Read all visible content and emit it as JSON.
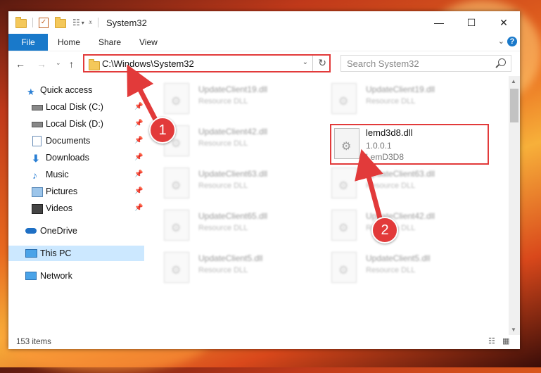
{
  "window": {
    "title": "System32",
    "minimize": "—",
    "maximize": "☐",
    "close": "✕"
  },
  "ribbon": {
    "tabs": [
      "File",
      "Home",
      "Share",
      "View"
    ],
    "expand_icon": "chevron-down-icon",
    "help": "?"
  },
  "address": {
    "path": "C:\\Windows\\System32",
    "search_placeholder": "Search System32"
  },
  "sidebar": {
    "items": [
      {
        "label": "Quick access",
        "icon": "star-icon",
        "pinned": false
      },
      {
        "label": "Local Disk (C:)",
        "icon": "drive-icon",
        "pinned": true
      },
      {
        "label": "Local Disk (D:)",
        "icon": "drive-icon",
        "pinned": true
      },
      {
        "label": "Documents",
        "icon": "documents-icon",
        "pinned": true
      },
      {
        "label": "Downloads",
        "icon": "download-icon",
        "pinned": true
      },
      {
        "label": "Music",
        "icon": "music-icon",
        "pinned": true
      },
      {
        "label": "Pictures",
        "icon": "pictures-icon",
        "pinned": true
      },
      {
        "label": "Videos",
        "icon": "videos-icon",
        "pinned": true
      },
      {
        "label": "OneDrive",
        "icon": "cloud-icon",
        "pinned": false
      },
      {
        "label": "This PC",
        "icon": "computer-icon",
        "pinned": false,
        "selected": true
      },
      {
        "label": "Network",
        "icon": "network-icon",
        "pinned": false
      }
    ]
  },
  "files": {
    "left": [
      {
        "name": "UpdateClient19.dll",
        "desc": "Resource DLL"
      },
      {
        "name": "UpdateClient42.dll",
        "desc": "Resource DLL"
      },
      {
        "name": "UpdateClient63.dll",
        "desc": "Resource DLL"
      },
      {
        "name": "UpdateClient65.dll",
        "desc": "Resource DLL"
      },
      {
        "name": "UpdateClient5.dll",
        "desc": "Resource DLL"
      }
    ],
    "right": [
      {
        "name": "UpdateClient19.dll",
        "desc": "Resource DLL"
      },
      {
        "name": "lemd3d8.dll",
        "desc": "1.0.0.1",
        "desc2": "LemD3D8"
      },
      {
        "name": "UpdateClient63.dll",
        "desc": "Resource DLL"
      },
      {
        "name": "UpdateClient42.dll",
        "desc": "Resource DLL"
      },
      {
        "name": "UpdateClient5.dll",
        "desc": "Resource DLL"
      }
    ]
  },
  "status": {
    "item_count": "153 items"
  },
  "callouts": [
    "1",
    "2"
  ],
  "colors": {
    "accent": "#1979ca",
    "highlight": "#e23a3a",
    "selected": "#cce8ff"
  }
}
